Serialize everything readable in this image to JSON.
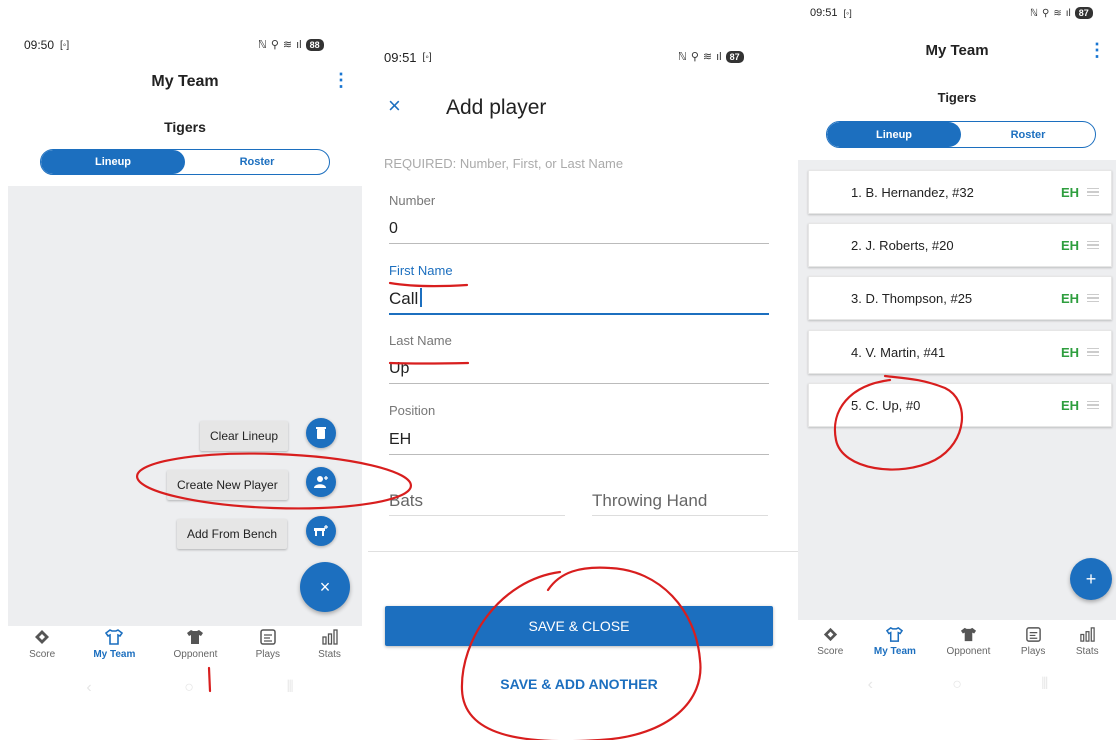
{
  "screen1": {
    "status": {
      "time": "09:50",
      "battery": "88"
    },
    "header": {
      "title": "My Team",
      "team_name": "Tigers"
    },
    "segment": {
      "lineup": "Lineup",
      "roster": "Roster"
    },
    "speed_dial": {
      "clear_lineup": "Clear Lineup",
      "create_new_player": "Create New Player",
      "add_from_bench": "Add From Bench",
      "close_icon": "×"
    },
    "nav": [
      {
        "label": "Score",
        "icon": "diamond-icon"
      },
      {
        "label": "My Team",
        "icon": "shirt-outline-icon"
      },
      {
        "label": "Opponent",
        "icon": "shirt-filled-icon"
      },
      {
        "label": "Plays",
        "icon": "list-icon"
      },
      {
        "label": "Stats",
        "icon": "bar-chart-icon"
      }
    ]
  },
  "screen2": {
    "status": {
      "time": "09:51",
      "battery": "87"
    },
    "header": {
      "close_icon": "×",
      "title": "Add player"
    },
    "required_note": "REQUIRED: Number, First, or Last Name",
    "fields": {
      "number": {
        "label": "Number",
        "value": "0"
      },
      "first_name": {
        "label": "First Name",
        "value": "Call"
      },
      "last_name": {
        "label": "Last Name",
        "value": "Up"
      },
      "position": {
        "label": "Position",
        "value": "EH"
      },
      "bats": {
        "label": "Bats"
      },
      "throwing_hand": {
        "label": "Throwing Hand"
      }
    },
    "buttons": {
      "save_close": "SAVE & CLOSE",
      "save_add_another": "SAVE & ADD ANOTHER"
    }
  },
  "screen3": {
    "status": {
      "time": "09:51",
      "battery": "87"
    },
    "header": {
      "title": "My Team",
      "team_name": "Tigers"
    },
    "segment": {
      "lineup": "Lineup",
      "roster": "Roster"
    },
    "lineup": [
      {
        "name": "1. B. Hernandez, #32",
        "position": "EH"
      },
      {
        "name": "2. J. Roberts, #20",
        "position": "EH"
      },
      {
        "name": "3. D. Thompson, #25",
        "position": "EH"
      },
      {
        "name": "4. V. Martin, #41",
        "position": "EH"
      },
      {
        "name": "5. C. Up, #0",
        "position": "EH"
      }
    ],
    "fab_icon": "+",
    "nav": [
      {
        "label": "Score",
        "icon": "diamond-icon"
      },
      {
        "label": "My Team",
        "icon": "shirt-outline-icon"
      },
      {
        "label": "Opponent",
        "icon": "shirt-filled-icon"
      },
      {
        "label": "Plays",
        "icon": "list-icon"
      },
      {
        "label": "Stats",
        "icon": "bar-chart-icon"
      }
    ]
  },
  "colors": {
    "primary": "#1c6fbf",
    "position_green": "#2e9e3e",
    "annotation_red": "#d81e1e"
  }
}
